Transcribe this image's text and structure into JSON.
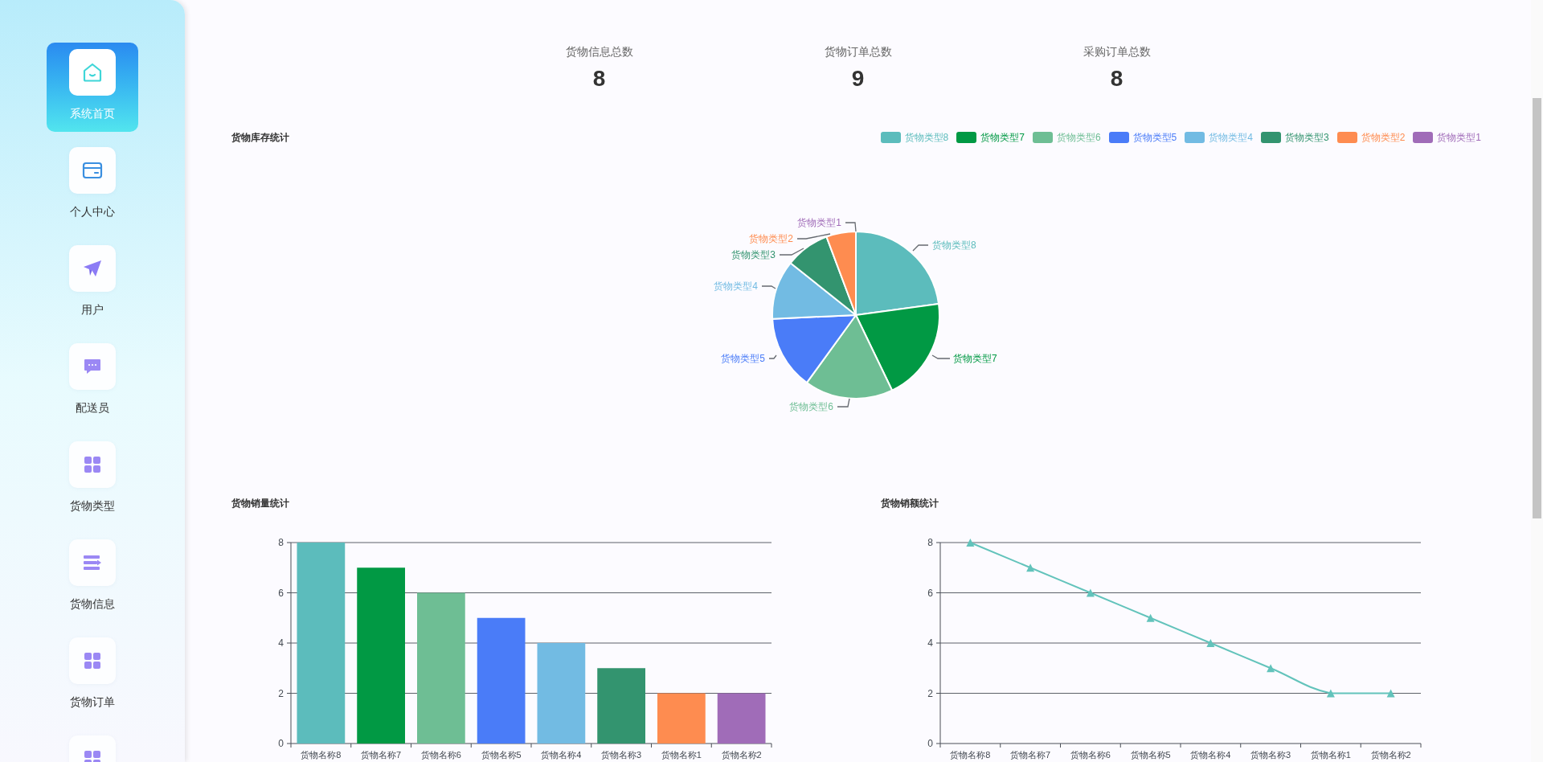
{
  "sidebar": {
    "items": [
      {
        "label": "系统首页",
        "selected": true
      },
      {
        "label": "个人中心",
        "selected": false
      },
      {
        "label": "用户",
        "selected": false
      },
      {
        "label": "配送员",
        "selected": false
      },
      {
        "label": "货物类型",
        "selected": false
      },
      {
        "label": "货物信息",
        "selected": false
      },
      {
        "label": "货物订单",
        "selected": false
      },
      {
        "selected": false
      }
    ]
  },
  "stats": [
    {
      "label": "货物信息总数",
      "value": "8"
    },
    {
      "label": "货物订单总数",
      "value": "9"
    },
    {
      "label": "采购订单总数",
      "value": "8"
    }
  ],
  "inventory_chart": {
    "title": "货物库存统计",
    "legend": [
      {
        "label": "货物类型8",
        "color": "#5cbcbc"
      },
      {
        "label": "货物类型7",
        "color": "#019944"
      },
      {
        "label": "货物类型6",
        "color": "#6ebe94"
      },
      {
        "label": "货物类型5",
        "color": "#4a7cf8"
      },
      {
        "label": "货物类型4",
        "color": "#72bbe3"
      },
      {
        "label": "货物类型3",
        "color": "#33946f"
      },
      {
        "label": "货物类型2",
        "color": "#fe8c50"
      },
      {
        "label": "货物类型1",
        "color": "#a06cb8"
      }
    ],
    "pie_labels": [
      {
        "label": "货物类型1",
        "color": "#a06cb8"
      },
      {
        "label": "货物类型2",
        "color": "#fe8c50"
      },
      {
        "label": "货物类型8",
        "color": "#5cbcbc"
      },
      {
        "label": "货物类型3",
        "color": "#33946f"
      },
      {
        "label": "货物类型4",
        "color": "#72bbe3"
      },
      {
        "label": "货物类型5",
        "color": "#4a7cf8"
      },
      {
        "label": "货物类型7",
        "color": "#019944"
      },
      {
        "label": "货物类型6",
        "color": "#6ebe94"
      }
    ]
  },
  "sales_volume_chart": {
    "chart_data": {
      "type": "bar",
      "title": "货物销量统计",
      "categories": [
        "货物名称8",
        "货物名称7",
        "货物名称6",
        "货物名称5",
        "货物名称4",
        "货物名称3",
        "货物名称1",
        "货物名称2"
      ],
      "values": [
        8,
        7,
        6,
        5,
        4,
        3,
        2,
        2
      ],
      "ylim": [
        0,
        8
      ],
      "yticks": [
        0,
        2,
        4,
        6,
        8
      ],
      "grid": true
    }
  },
  "sales_amount_chart": {
    "chart_data": {
      "type": "line",
      "title": "货物销额统计",
      "categories": [
        "货物名称8",
        "货物名称7",
        "货物名称6",
        "货物名称5",
        "货物名称4",
        "货物名称3",
        "货物名称1",
        "货物名称2"
      ],
      "series": [
        {
          "color": "#62c3bb",
          "marker": "triangle",
          "values": [
            8,
            7,
            6,
            5,
            4,
            3,
            2,
            2
          ]
        }
      ],
      "ylim": [
        0,
        8
      ],
      "yticks": [
        0,
        2,
        4,
        6,
        8
      ],
      "grid": true
    }
  }
}
